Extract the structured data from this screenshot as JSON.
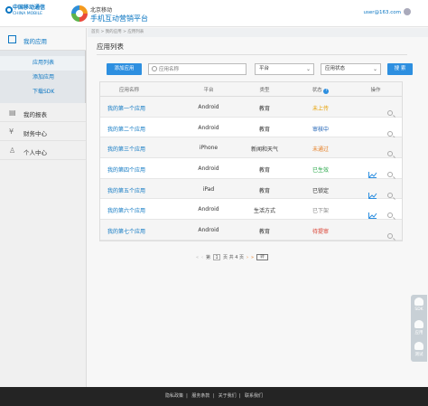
{
  "header": {
    "logo_cn": "中国移动通信",
    "logo_en": "CHINA MOBILE",
    "region": "北京移动",
    "platform": "手机互动营销平台",
    "user_email": "user@163.com"
  },
  "sidebar": {
    "my_apps": "我的应用",
    "sub_items": [
      "应用列表",
      "添加应用",
      "下载SDK"
    ],
    "sections": [
      {
        "label": "我的报表",
        "icon": "report-icon"
      },
      {
        "label": "财务中心",
        "icon": "finance-icon"
      },
      {
        "label": "个人中心",
        "icon": "user-icon"
      }
    ]
  },
  "breadcrumb": {
    "home": "首页",
    "sep": ">",
    "l1": "我的应用",
    "l2": "应用列表"
  },
  "main": {
    "title": "应用列表",
    "add_button": "添加应用",
    "search_placeholder": "应用名称",
    "platform_select": "平台",
    "status_select": "应用状态",
    "search_button": "搜 索"
  },
  "table": {
    "headers": [
      "应用名称",
      "平台",
      "类型",
      "状态",
      "操作"
    ],
    "rows": [
      {
        "name": "我的第一个应用",
        "platform": "Android",
        "type": "教育",
        "status": "未上传",
        "status_color": "#e6a000",
        "chart": false
      },
      {
        "name": "我的第二个应用",
        "platform": "Android",
        "type": "教育",
        "status": "审核中",
        "status_color": "#1a5fb4",
        "chart": false
      },
      {
        "name": "我的第三个应用",
        "platform": "iPhone",
        "type": "新闻和天气",
        "status": "未通过",
        "status_color": "#e67e22",
        "chart": false
      },
      {
        "name": "我的第四个应用",
        "platform": "Android",
        "type": "教育",
        "status": "已生效",
        "status_color": "#2aa84a",
        "chart": true
      },
      {
        "name": "我的第五个应用",
        "platform": "iPad",
        "type": "教育",
        "status": "已锁定",
        "status_color": "#333333",
        "chart": true
      },
      {
        "name": "我的第六个应用",
        "platform": "Android",
        "type": "生活方式",
        "status": "已下架",
        "status_color": "#888888",
        "chart": true
      },
      {
        "name": "我的第七个应用",
        "platform": "Android",
        "type": "教育",
        "status": "待提审",
        "status_color": "#d93a2b",
        "chart": false
      }
    ]
  },
  "pager": {
    "prev": "«",
    "first": "‹",
    "page_prefix": "第",
    "page": "1",
    "total": "页 共 4 页",
    "next": "›",
    "last": "»",
    "go": "转"
  },
  "side_tools": [
    "SDK",
    "应用",
    "测试"
  ],
  "footer": [
    "隐私政策",
    "服务条款",
    "关于我们",
    "联系我们"
  ]
}
